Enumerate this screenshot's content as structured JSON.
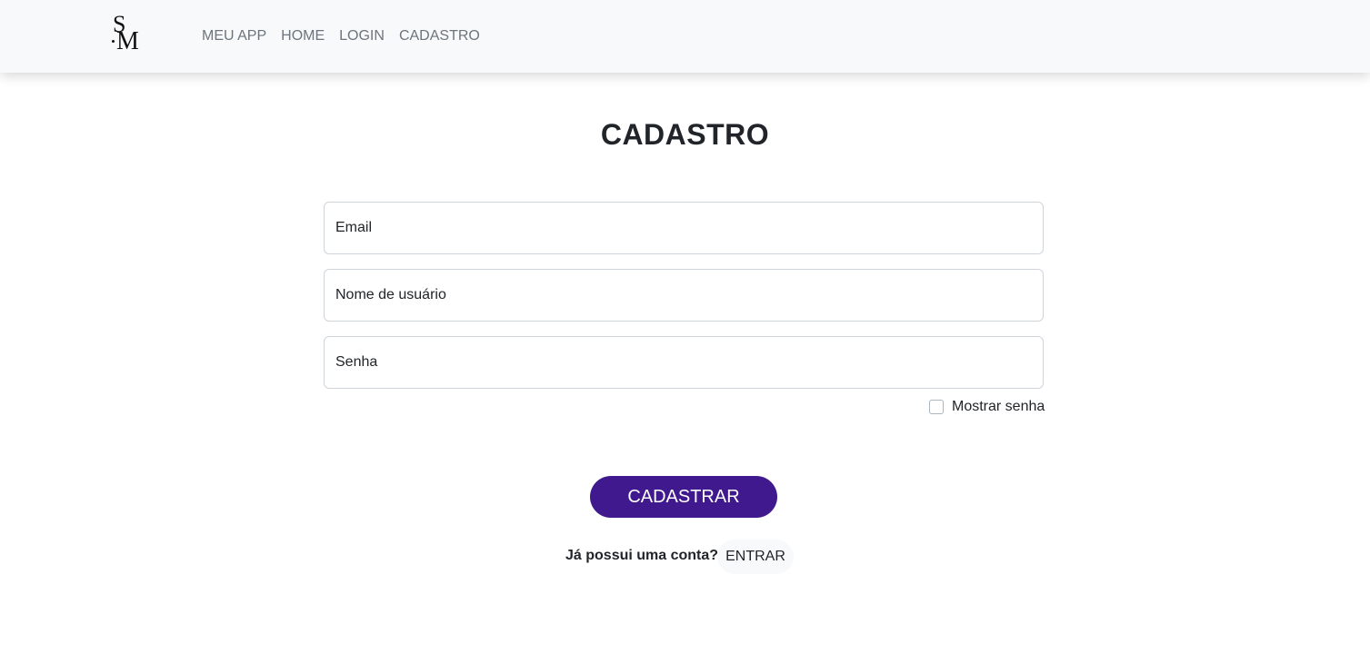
{
  "navbar": {
    "logo_text": "SM",
    "logo_s": "S",
    "logo_m": "M",
    "links": [
      {
        "label": "MEU APP"
      },
      {
        "label": "HOME"
      },
      {
        "label": "LOGIN"
      },
      {
        "label": "CADASTRO"
      }
    ]
  },
  "page": {
    "title": "CADASTRO"
  },
  "form": {
    "email_placeholder": "Email",
    "email_value": "",
    "username_placeholder": "Nome de usuário",
    "username_value": "",
    "password_placeholder": "Senha",
    "password_value": "",
    "show_password_label": "Mostrar senha",
    "show_password_checked": false,
    "submit_label": "CADASTRAR",
    "has_account_text": "Já possui uma conta?",
    "enter_label": "ENTRAR"
  },
  "colors": {
    "primary": "#41198f",
    "navbar_bg": "#f8f9fa",
    "nav_link": "#6c757d"
  }
}
